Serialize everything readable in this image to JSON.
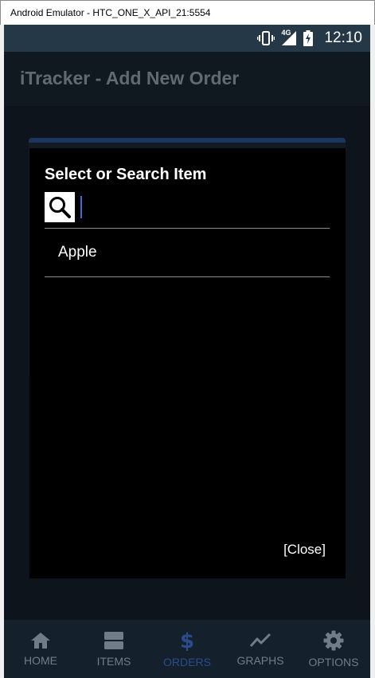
{
  "window": {
    "title": "Android Emulator - HTC_ONE_X_API_21:5554"
  },
  "statusbar": {
    "time": "12:10",
    "network": "4G",
    "icons": [
      "vibrate-icon",
      "signal-icon",
      "battery-charging-icon"
    ]
  },
  "appbar": {
    "title": "iTracker - Add New Order"
  },
  "dialog": {
    "title": "Select or Search Item",
    "search": {
      "value": "",
      "placeholder": ""
    },
    "items": [
      "Apple"
    ],
    "close_label": "[Close]"
  },
  "bottomnav": {
    "items": [
      {
        "label": "HOME",
        "icon": "home-icon",
        "active": false
      },
      {
        "label": "ITEMS",
        "icon": "items-icon",
        "active": false
      },
      {
        "label": "ORDERS",
        "icon": "dollar-icon",
        "active": true
      },
      {
        "label": "GRAPHS",
        "icon": "graph-icon",
        "active": false
      },
      {
        "label": "OPTIONS",
        "icon": "gear-icon",
        "active": false
      }
    ]
  },
  "colors": {
    "accent": "#2b4c8c",
    "statusbar": "#253847",
    "background": "#121820",
    "inactive": "#717d86"
  }
}
